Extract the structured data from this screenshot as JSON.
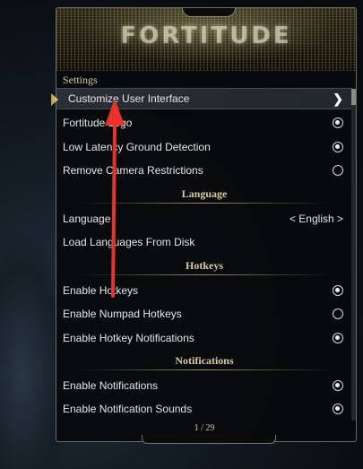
{
  "menu": {
    "title": "FORTITUDE",
    "settings_label": "Settings",
    "page_indicator": "1 / 29"
  },
  "rows": [
    {
      "label": "Customize User Interface",
      "type": "submenu",
      "chevron": "❯",
      "selected": true
    },
    {
      "label": "Fortitude Logo",
      "type": "radio",
      "checked": true
    },
    {
      "label": "Low Latency Ground Detection",
      "type": "radio",
      "checked": true
    },
    {
      "label": "Remove Camera Restrictions",
      "type": "radio",
      "checked": false
    },
    {
      "section": "Language"
    },
    {
      "label": "Language",
      "type": "select",
      "value": "< English >"
    },
    {
      "label": "Load Languages From Disk",
      "type": "action"
    },
    {
      "section": "Hotkeys"
    },
    {
      "label": "Enable Hotkeys",
      "type": "radio",
      "checked": true
    },
    {
      "label": "Enable Numpad Hotkeys",
      "type": "radio",
      "checked": false
    },
    {
      "label": "Enable Hotkey Notifications",
      "type": "radio",
      "checked": true
    },
    {
      "section": "Notifications"
    },
    {
      "label": "Enable Notifications",
      "type": "radio",
      "checked": true
    },
    {
      "label": "Enable Notification Sounds",
      "type": "radio",
      "checked": true
    }
  ],
  "colors": {
    "annotation_arrow": "#e8332b",
    "accent_gold": "#d8c9a4"
  }
}
